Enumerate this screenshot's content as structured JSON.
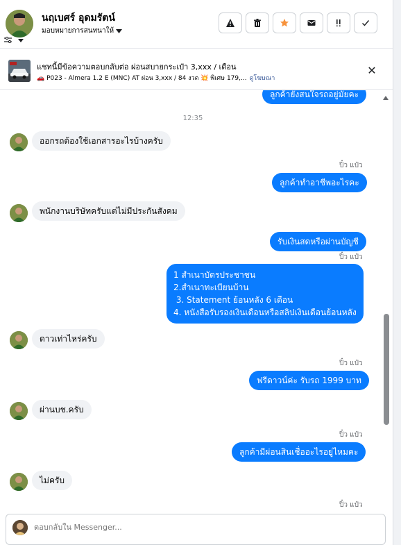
{
  "header": {
    "contact_name": "นฤเบศร์ อุดมรัตน์",
    "assign_label": "มอบหมายการสนทนาให้",
    "actions": [
      {
        "name": "report-button",
        "icon": "warning-icon",
        "glyph": "⚠"
      },
      {
        "name": "delete-button",
        "icon": "trash-icon",
        "glyph": "🗑"
      },
      {
        "name": "star-button",
        "icon": "star-icon",
        "glyph": "★"
      },
      {
        "name": "mark-unread-button",
        "icon": "envelope-icon",
        "glyph": "✉"
      },
      {
        "name": "follow-up-button",
        "icon": "exclamation-icon",
        "glyph": "!!"
      },
      {
        "name": "done-button",
        "icon": "check-icon",
        "glyph": "✓"
      }
    ]
  },
  "banner": {
    "title": "แชทนี้มีข้อความตอบกลับต่อ ผ่อนสบายกระเป๋า 3,xxx / เดือน",
    "subtitle": "🚗 P023 - Almera 1.2 E (MNC) AT ผ่อน 3,xxx / 84 งวด 💥 พิเศษ 179,...",
    "link": "ดูโฆษณา",
    "close": "✕"
  },
  "chat": {
    "partial_top": "ลูกค้ายังสนใจรถอยู่มั้ยคะ",
    "timestamp": "12:35",
    "messages": [
      {
        "side": "in",
        "text": "ออกรถต้องใช้เอกสารอะไรบ้างครับ"
      },
      {
        "side": "out",
        "sender": "ปิ๋ว แป๋ว",
        "text": "ลูกค้าทำอาชีพอะไรคะ"
      },
      {
        "side": "in",
        "text": "พนักงานบริษัทครับแต่ไม่มีประกันสังคม"
      },
      {
        "side": "out",
        "text": "รับเงินสดหรือผ่านบัญชี"
      },
      {
        "side": "out",
        "sender": "ปิ๋ว แป๋ว",
        "lines": [
          "1 สำเนาบัตรประชาชน",
          "2.สำเนาทะเบียนบ้าน",
          " 3. Statement ย้อนหลัง 6 เดือน",
          "4. หนังสือรับรองเงินเดือนหรือสลิปเงินเดือนย้อนหลัง"
        ]
      },
      {
        "side": "in",
        "text": "ดาวเท่าไหร่ครับ"
      },
      {
        "side": "out",
        "sender": "ปิ๋ว แป๋ว",
        "text": "ฟรีดาวน์ค่ะ  รับรถ 1999 บาท"
      },
      {
        "side": "in",
        "text": "ผ่านบช.ครับ"
      },
      {
        "side": "out",
        "sender": "ปิ๋ว แป๋ว",
        "text": "ลูกค้ามีผ่อนสินเชื่ออะไรอยู่ไหมคะ"
      },
      {
        "side": "in",
        "text": "ไม่ครับ"
      },
      {
        "side": "out",
        "sender": "ปิ๋ว แป๋ว"
      }
    ]
  },
  "composer": {
    "placeholder": "ตอบกลับใน Messenger..."
  },
  "colors": {
    "outgoing_bubble": "#0a7cff",
    "incoming_bubble": "#f0f2f5",
    "star_accent": "#f7923b"
  }
}
